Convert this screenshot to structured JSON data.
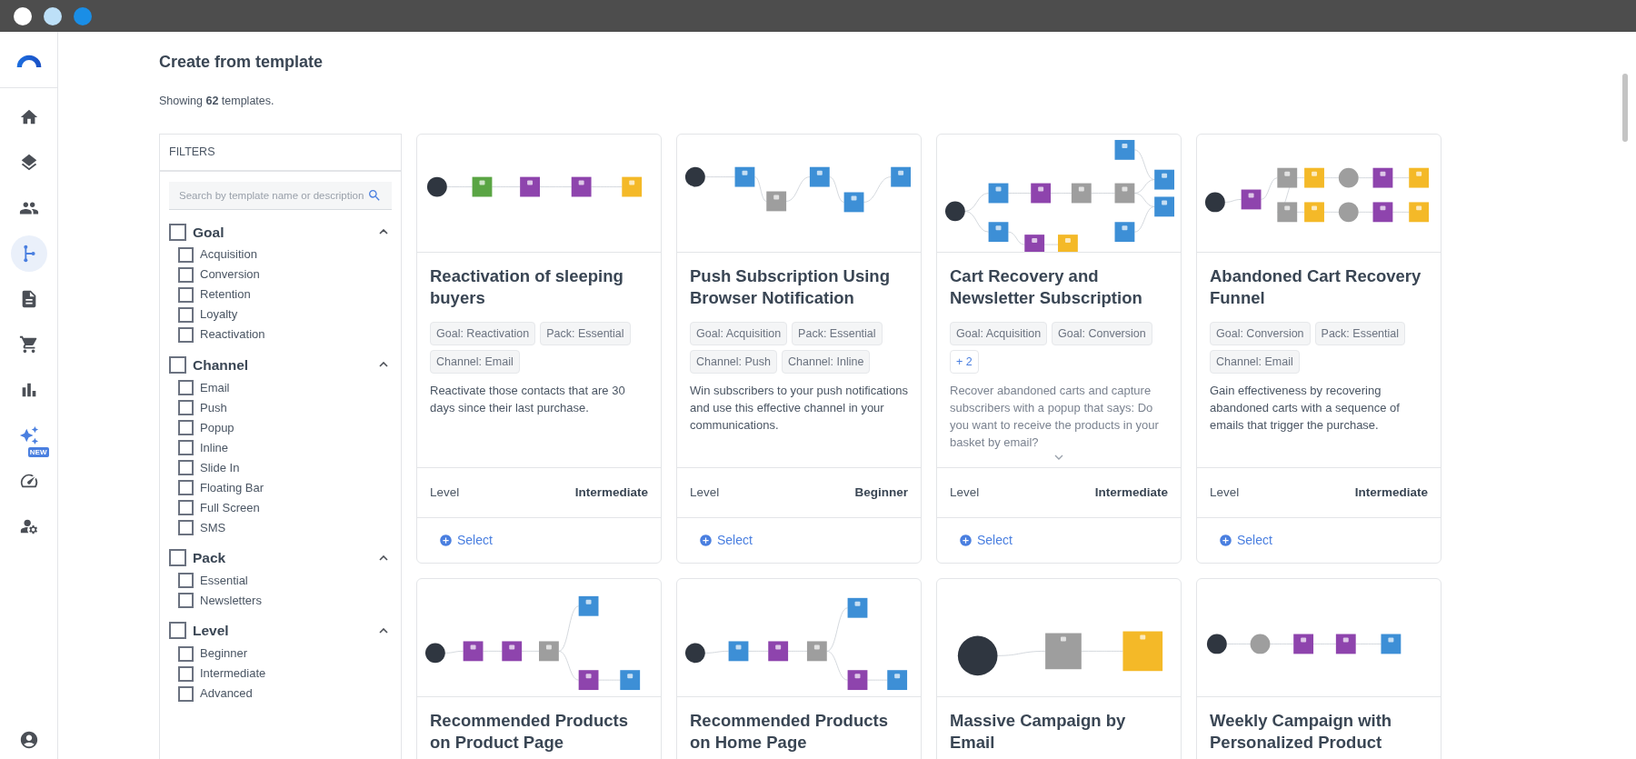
{
  "sidebar": {
    "items": [
      {
        "selected": false
      },
      {
        "selected": false
      },
      {
        "selected": false
      },
      {
        "selected": true
      },
      {
        "selected": false
      },
      {
        "selected": false
      },
      {
        "selected": false
      },
      {
        "selected": false,
        "badge": "NEW"
      },
      {
        "selected": false
      },
      {
        "selected": false
      }
    ]
  },
  "page": {
    "title": "Create from template",
    "summary": "Showing **62** templates."
  },
  "filters": {
    "title": "FILTERS",
    "search": {
      "placeholder": "Search by template name or description"
    },
    "groups": [
      {
        "label": "Goal",
        "checked": false,
        "expanded": true,
        "options": [
          {
            "label": "Acquisition",
            "checked": false
          },
          {
            "label": "Conversion",
            "checked": false
          },
          {
            "label": "Retention",
            "checked": false
          },
          {
            "label": "Loyalty",
            "checked": false
          },
          {
            "label": "Reactivation",
            "checked": false
          }
        ]
      },
      {
        "label": "Channel",
        "checked": false,
        "expanded": true,
        "options": [
          {
            "label": "Email",
            "checked": false
          },
          {
            "label": "Push",
            "checked": false
          },
          {
            "label": "Popup",
            "checked": false
          },
          {
            "label": "Inline",
            "checked": false
          },
          {
            "label": "Slide In",
            "checked": false
          },
          {
            "label": "Floating Bar",
            "checked": false
          },
          {
            "label": "Full Screen",
            "checked": false
          },
          {
            "label": "SMS",
            "checked": false
          }
        ]
      },
      {
        "label": "Pack",
        "checked": false,
        "expanded": true,
        "options": [
          {
            "label": "Essential",
            "checked": false
          },
          {
            "label": "Newsletters",
            "checked": false
          }
        ]
      },
      {
        "label": "Level",
        "checked": false,
        "expanded": true,
        "options": [
          {
            "label": "Beginner",
            "checked": false
          },
          {
            "label": "Intermediate",
            "checked": false
          },
          {
            "label": "Advanced",
            "checked": false
          }
        ]
      }
    ]
  },
  "templates": [
    {
      "title": "Reactivation of sleeping buyers",
      "tags": [
        "Goal: Reactivation",
        "Pack: Essential",
        "Channel: Email"
      ],
      "description": "Reactivate those contacts that are 30 days since their last purchase.",
      "level_label": "Level",
      "level": "Intermediate",
      "action": "Select"
    },
    {
      "title": "Push Subscription Using Browser Notification",
      "tags": [
        "Goal: Acquisition",
        "Pack: Essential",
        "Channel: Push",
        "Channel: Inline"
      ],
      "description": "Win subscribers to your push notifications and use this effective channel in your communications.",
      "level_label": "Level",
      "level": "Beginner",
      "action": "Select"
    },
    {
      "title": "Cart Recovery and Newsletter Subscription",
      "tags": [
        "Goal: Acquisition",
        "Goal: Conversion"
      ],
      "more": "+ 2",
      "description": "Recover abandoned carts and capture subscribers with a popup that says: Do you want to receive the products in your basket by email?",
      "collapsed": true,
      "level_label": "Level",
      "level": "Intermediate",
      "action": "Select"
    },
    {
      "title": "Abandoned Cart Recovery Funnel",
      "tags": [
        "Goal: Conversion",
        "Pack: Essential",
        "Channel: Email"
      ],
      "description": "Gain effectiveness by recovering abandoned carts with a sequence of emails that trigger the purchase.",
      "level_label": "Level",
      "level": "Intermediate",
      "action": "Select"
    },
    {
      "title": "Recommended Products on Product Page"
    },
    {
      "title": "Recommended Products on Home Page"
    },
    {
      "title": "Massive Campaign by Email"
    },
    {
      "title": "Weekly Campaign with Personalized Product"
    }
  ]
}
